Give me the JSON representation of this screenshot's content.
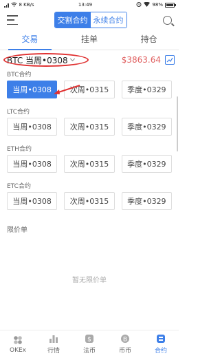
{
  "status": {
    "signal": "ᵢₗ",
    "speed": "8 KB/s",
    "time": "13:49",
    "battery": "98%",
    "battery_level": 0.98
  },
  "header": {
    "seg_delivery": "交割合约",
    "seg_perpetual": "永续合约",
    "menu_icon": "menu-icon",
    "search_icon": "search-icon"
  },
  "tabs": [
    "交易",
    "挂单",
    "持仓"
  ],
  "contract": {
    "selected": "BTC 当周•0308",
    "price": "$3863.64",
    "chart_icon": "candlestick-chart-icon"
  },
  "sections": [
    {
      "label": "BTC合约",
      "options": [
        "当周•0308",
        "次周•0315",
        "季度•0329"
      ]
    },
    {
      "label": "LTC合约",
      "options": [
        "当周•0308",
        "次周•0315",
        "季度•0329"
      ]
    },
    {
      "label": "ETH合约",
      "options": [
        "当周•0308",
        "次周•0315",
        "季度•0329"
      ]
    },
    {
      "label": "ETC合约",
      "options": [
        "当周•0308",
        "次周•0315",
        "季度•0329"
      ]
    }
  ],
  "limit": {
    "title": "限价单",
    "empty": "暂无限价单"
  },
  "bottom_nav": [
    "OKEx",
    "行情",
    "法币",
    "币币",
    "合约"
  ],
  "colors": {
    "accent": "#3d7fe8",
    "price": "#e06060",
    "annotation": "#e03030"
  }
}
